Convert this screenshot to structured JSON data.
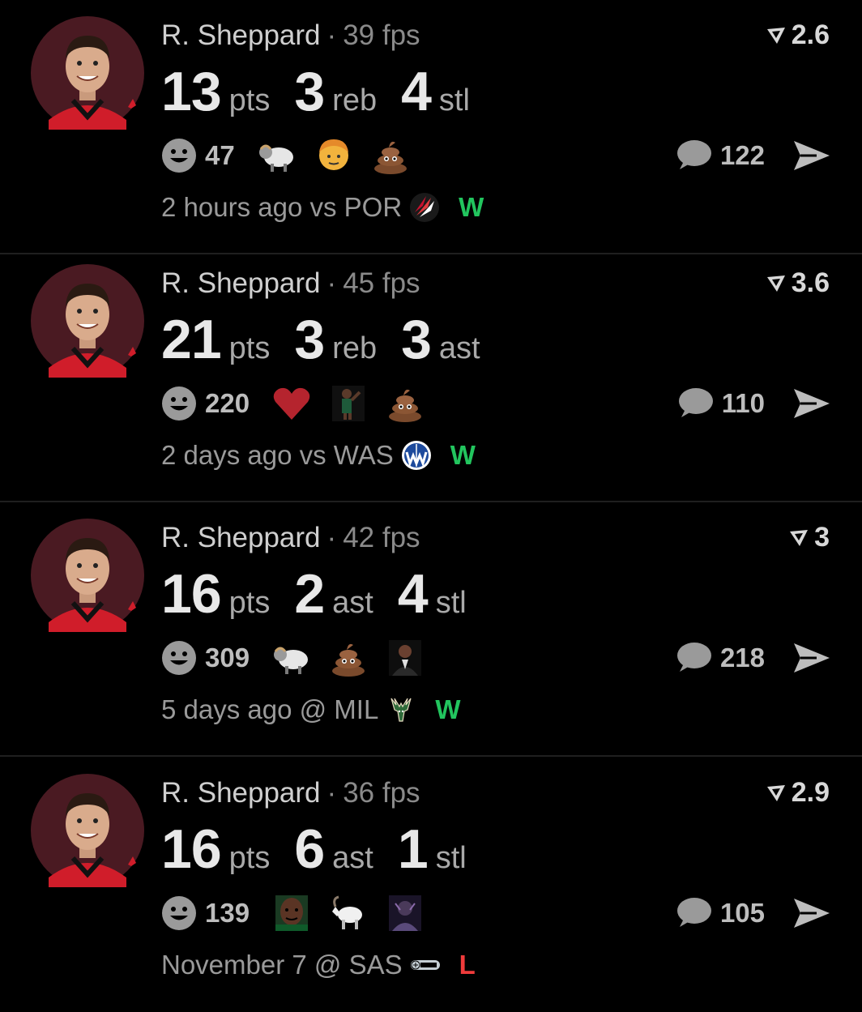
{
  "colors": {
    "background": "#000000",
    "win": "#22c55e",
    "loss": "#ef3b3b",
    "divider": "#1f1f1f"
  },
  "feed": [
    {
      "player": "R. Sheppard",
      "separator": "·",
      "fps": "39 fps",
      "rating": "2.6",
      "stats": [
        {
          "value": "13",
          "unit": "pts"
        },
        {
          "value": "3",
          "unit": "reb"
        },
        {
          "value": "4",
          "unit": "stl"
        }
      ],
      "reaction_count": "47",
      "reactions": [
        "sheep-emoji",
        "person-emoji",
        "poop-emoji"
      ],
      "comment_count": "122",
      "game_info": "2 hours ago vs POR",
      "team_icon": "blazers-logo-icon",
      "result": "W",
      "result_color": "#22c55e"
    },
    {
      "player": "R. Sheppard",
      "separator": "·",
      "fps": "45 fps",
      "rating": "3.6",
      "stats": [
        {
          "value": "21",
          "unit": "pts"
        },
        {
          "value": "3",
          "unit": "reb"
        },
        {
          "value": "3",
          "unit": "ast"
        }
      ],
      "reaction_count": "220",
      "reactions": [
        "heart-emoji",
        "player-sticker",
        "poop-emoji"
      ],
      "comment_count": "110",
      "game_info": "2 days ago vs WAS",
      "team_icon": "wizards-logo-icon",
      "result": "W",
      "result_color": "#22c55e"
    },
    {
      "player": "R. Sheppard",
      "separator": "·",
      "fps": "42 fps",
      "rating": "3",
      "stats": [
        {
          "value": "16",
          "unit": "pts"
        },
        {
          "value": "2",
          "unit": "ast"
        },
        {
          "value": "4",
          "unit": "stl"
        }
      ],
      "reaction_count": "309",
      "reactions": [
        "sheep-emoji",
        "poop-emoji",
        "man-sticker"
      ],
      "comment_count": "218",
      "game_info": "5 days ago @ MIL",
      "team_icon": "bucks-logo-icon",
      "result": "W",
      "result_color": "#22c55e"
    },
    {
      "player": "R. Sheppard",
      "separator": "·",
      "fps": "36 fps",
      "rating": "2.9",
      "stats": [
        {
          "value": "16",
          "unit": "pts"
        },
        {
          "value": "6",
          "unit": "ast"
        },
        {
          "value": "1",
          "unit": "stl"
        }
      ],
      "reaction_count": "139",
      "reactions": [
        "face-sticker",
        "goat-emoji",
        "dark-sticker"
      ],
      "comment_count": "105",
      "game_info": "November 7 @ SAS",
      "team_icon": "spurs-logo-icon",
      "result": "L",
      "result_color": "#ef3b3b"
    }
  ]
}
